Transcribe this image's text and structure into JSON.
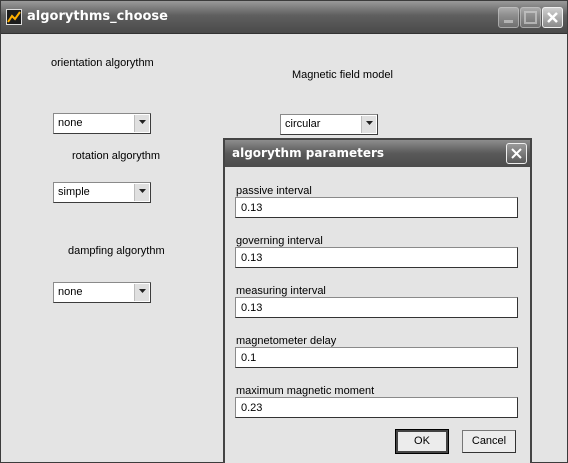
{
  "window": {
    "title": "algorythms_choose"
  },
  "left_panel": {
    "orientation": {
      "label": "orientation algorythm",
      "selected": "none"
    },
    "rotation": {
      "label": "rotation algorythm",
      "selected": "simple"
    },
    "damping": {
      "label": "dampfing algorythm",
      "selected": "none"
    }
  },
  "magnetic": {
    "label": "Magnetic field model",
    "selected": "circular"
  },
  "dialog": {
    "title": "algorythm parameters",
    "fields": [
      {
        "label": "passive interval",
        "value": "0.13"
      },
      {
        "label": "governing interval",
        "value": "0.13"
      },
      {
        "label": "measuring interval",
        "value": "0.13"
      },
      {
        "label": "magnetometer delay",
        "value": "0.1"
      },
      {
        "label": "maximum magnetic moment",
        "value": "0.23"
      }
    ],
    "ok_label": "OK",
    "cancel_label": "Cancel"
  },
  "icons": {
    "app": "matlab-figure-icon",
    "minimize": "minimize-icon",
    "maximize": "maximize-icon",
    "close": "close-icon",
    "dropdown": "chevron-down-icon"
  }
}
